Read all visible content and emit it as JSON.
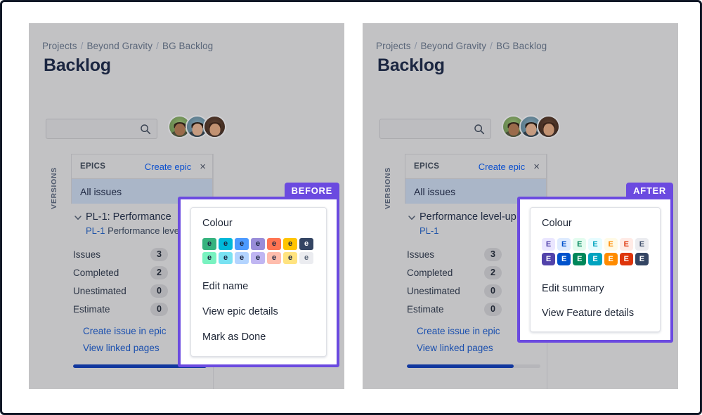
{
  "theme": {
    "panel_bg": "#c2c2c4",
    "accent_purple": "#6b4ae0",
    "link_blue": "#1a4fae",
    "selected_row": "#aab6c8",
    "progress_blue": "#11379e"
  },
  "panels": [
    {
      "id": "before",
      "badge": "BEFORE",
      "breadcrumb": [
        "Projects",
        "Beyond Gravity",
        "BG Backlog"
      ],
      "breadcrumb_sep": "/",
      "page_title": "Backlog",
      "search": {
        "value": "",
        "placeholder": ""
      },
      "versions_rail_label": "VERSIONS",
      "epics": {
        "header_label": "EPICS",
        "create_label": "Create epic",
        "close_label": "×",
        "all_issues_label": "All issues"
      },
      "epic": {
        "name_main": "PL-1: Performance",
        "sub_key": "PL-1",
        "sub_title": "Performance level-up",
        "stats": [
          {
            "label": "Issues",
            "value": "3"
          },
          {
            "label": "Completed",
            "value": "2"
          },
          {
            "label": "Unestimated",
            "value": "0"
          },
          {
            "label": "Estimate",
            "value": "0"
          }
        ],
        "links": [
          "Create issue in epic",
          "View linked pages"
        ],
        "progress_percent": 100
      },
      "menu": {
        "heading": "Colour",
        "swatch_rows": [
          [
            "#36b37e",
            "#00b8d9",
            "#4c9aff",
            "#998dd9",
            "#ff7452",
            "#ffc400",
            "#344563"
          ],
          [
            "#79f2c0",
            "#79e2f2",
            "#b3d4ff",
            "#c0b6f2",
            "#ffbdad",
            "#ffe380",
            "#ebecf0"
          ]
        ],
        "swatch_glyph": "e",
        "swatch_text_colors": [
          [
            "#1b2641",
            "#1b2641",
            "#1b2641",
            "#1b2641",
            "#1b2641",
            "#1b2641",
            "#ffffff"
          ],
          [
            "#1b2641",
            "#1b2641",
            "#1b2641",
            "#1b2641",
            "#1b2641",
            "#1b2641",
            "#5a6679"
          ]
        ],
        "items": [
          "Edit name",
          "View epic details",
          "Mark as Done"
        ]
      }
    },
    {
      "id": "after",
      "badge": "AFTER",
      "breadcrumb": [
        "Projects",
        "Beyond Gravity",
        "BG Backlog"
      ],
      "breadcrumb_sep": "/",
      "page_title": "Backlog",
      "search": {
        "value": "",
        "placeholder": ""
      },
      "versions_rail_label": "VERSIONS",
      "epics": {
        "header_label": "EPICS",
        "create_label": "Create epic",
        "close_label": "×",
        "all_issues_label": "All issues"
      },
      "epic": {
        "name_main": "Performance level-up",
        "sub_key": "PL-1",
        "sub_title": "",
        "stats": [
          {
            "label": "Issues",
            "value": "3"
          },
          {
            "label": "Completed",
            "value": "2"
          },
          {
            "label": "Unestimated",
            "value": "0"
          },
          {
            "label": "Estimate",
            "value": "0"
          }
        ],
        "links": [
          "Create issue in epic",
          "View linked pages"
        ],
        "progress_percent": 80
      },
      "menu": {
        "heading": "Colour",
        "swatch_rows": [
          [
            "#eae6ff",
            "#deebff",
            "#e3fcef",
            "#e6fcff",
            "#fffae6",
            "#ffebe6",
            "#ebecf0"
          ],
          [
            "#5243aa",
            "#0052cc",
            "#00875a",
            "#00a3bf",
            "#ff8b00",
            "#de350b",
            "#344563"
          ]
        ],
        "swatch_glyph": "E",
        "swatch_text_colors": [
          [
            "#5243aa",
            "#0052cc",
            "#00875a",
            "#00a3bf",
            "#ff8b00",
            "#de350b",
            "#42526e"
          ],
          [
            "#ffffff",
            "#ffffff",
            "#ffffff",
            "#ffffff",
            "#ffffff",
            "#ffffff",
            "#ffffff"
          ]
        ],
        "items": [
          "Edit summary",
          "View Feature details"
        ]
      }
    }
  ]
}
